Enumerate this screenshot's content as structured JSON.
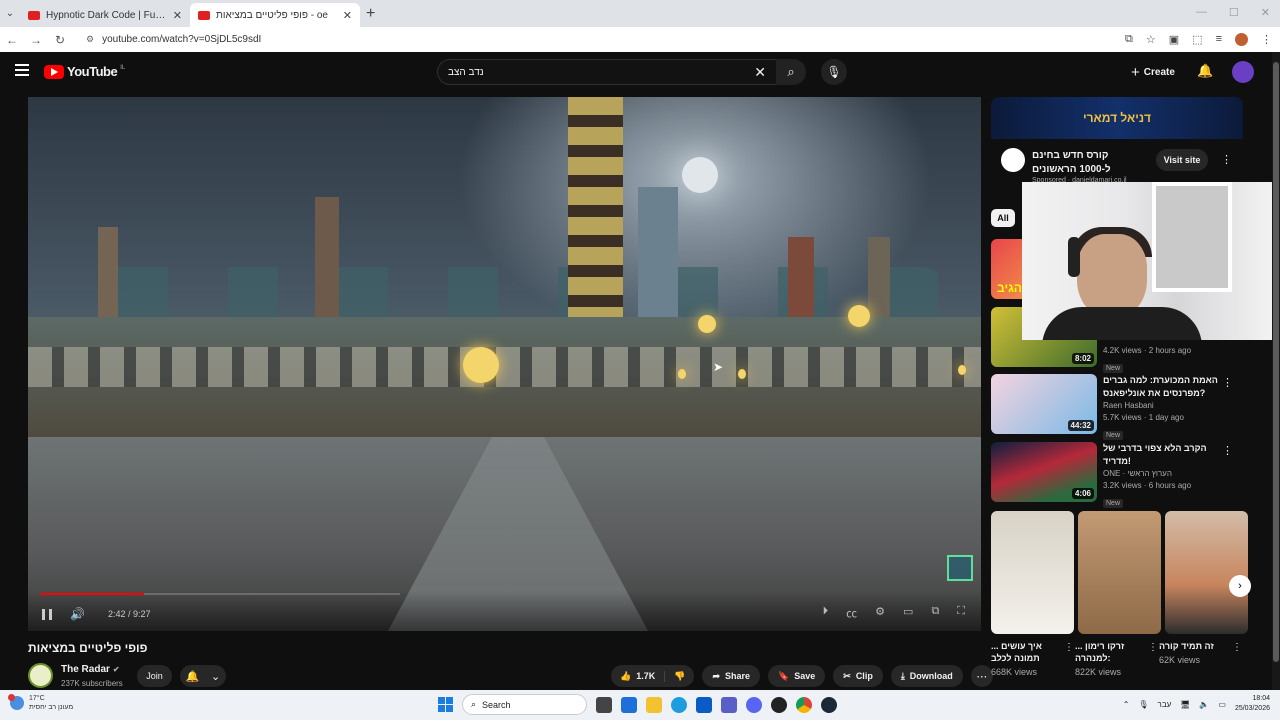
{
  "browser": {
    "tabs": [
      {
        "title": "Hypnotic Dark Code | Futuristic",
        "active": false
      },
      {
        "title": "פופי פליטיים במציאות - oe",
        "active": true
      }
    ],
    "url": "youtube.com/watch?v=0SjDL5c9sdI"
  },
  "youtube": {
    "logo_text": "YouTube",
    "country": "IL",
    "search_value": "נדב הצב",
    "create_label": "Create"
  },
  "player": {
    "time": "2:42 / 9:27",
    "progress": 0.29
  },
  "video": {
    "title": "פופי פליטיים במציאות",
    "channel": "The Radar",
    "subscribers": "237K subscribers",
    "join_label": "Join",
    "likes": "1.7K",
    "share_label": "Share",
    "save_label": "Save",
    "clip_label": "Clip",
    "download_label": "Download"
  },
  "ad": {
    "banner": "דניאל דמארי",
    "title": "קורס חדש בחינם ל-1000 הראשונים",
    "sponsored": "Sponsored · danieldamari.co.il",
    "visit_label": "Visit site"
  },
  "chips": {
    "all": "All"
  },
  "recommendations": [
    {
      "thumb_color": "#e9454a",
      "duration": "",
      "title": "",
      "channel": "",
      "meta": "",
      "new": false,
      "thumb_text": "הגיב"
    },
    {
      "thumb_color": "#3d6b2c",
      "duration": "8:02",
      "title": "",
      "channel": "",
      "meta": "4.2K views · 2 hours ago",
      "new": true,
      "thumb_text": ""
    },
    {
      "thumb_color": "#7ab9e6",
      "duration": "44:32",
      "title": "האמת המכוערת: למה גברים מפרנסים את אונליפאנס?",
      "channel": "Raen Hasbani",
      "meta": "5.7K views · 1 day ago",
      "new": true,
      "thumb_text": ""
    },
    {
      "thumb_color": "#2a6a3e",
      "duration": "4:06",
      "title": "הקרב הלא צפוי בדרבי של מדריד!",
      "channel": "ONE · הערוץ הראשי",
      "meta": "3.2K views · 6 hours ago",
      "new": true,
      "thumb_text": ""
    }
  ],
  "shorts": [
    {
      "title": "איך עושים ... תמונה לכלב",
      "views": "668K views",
      "color": "#e9e4dc"
    },
    {
      "title": "זרקו רימון ... למנהרה:",
      "views": "822K views",
      "color": "#b68a62"
    },
    {
      "title": "זה תמיד קורה",
      "views": "62K views",
      "color": "#d99970"
    }
  ],
  "taskbar": {
    "temp": "17°C",
    "weather_desc": "מעונן רב יחסית",
    "search_label": "Search",
    "lang": "עבר",
    "time": "18:04",
    "date": "25/03/2026"
  }
}
